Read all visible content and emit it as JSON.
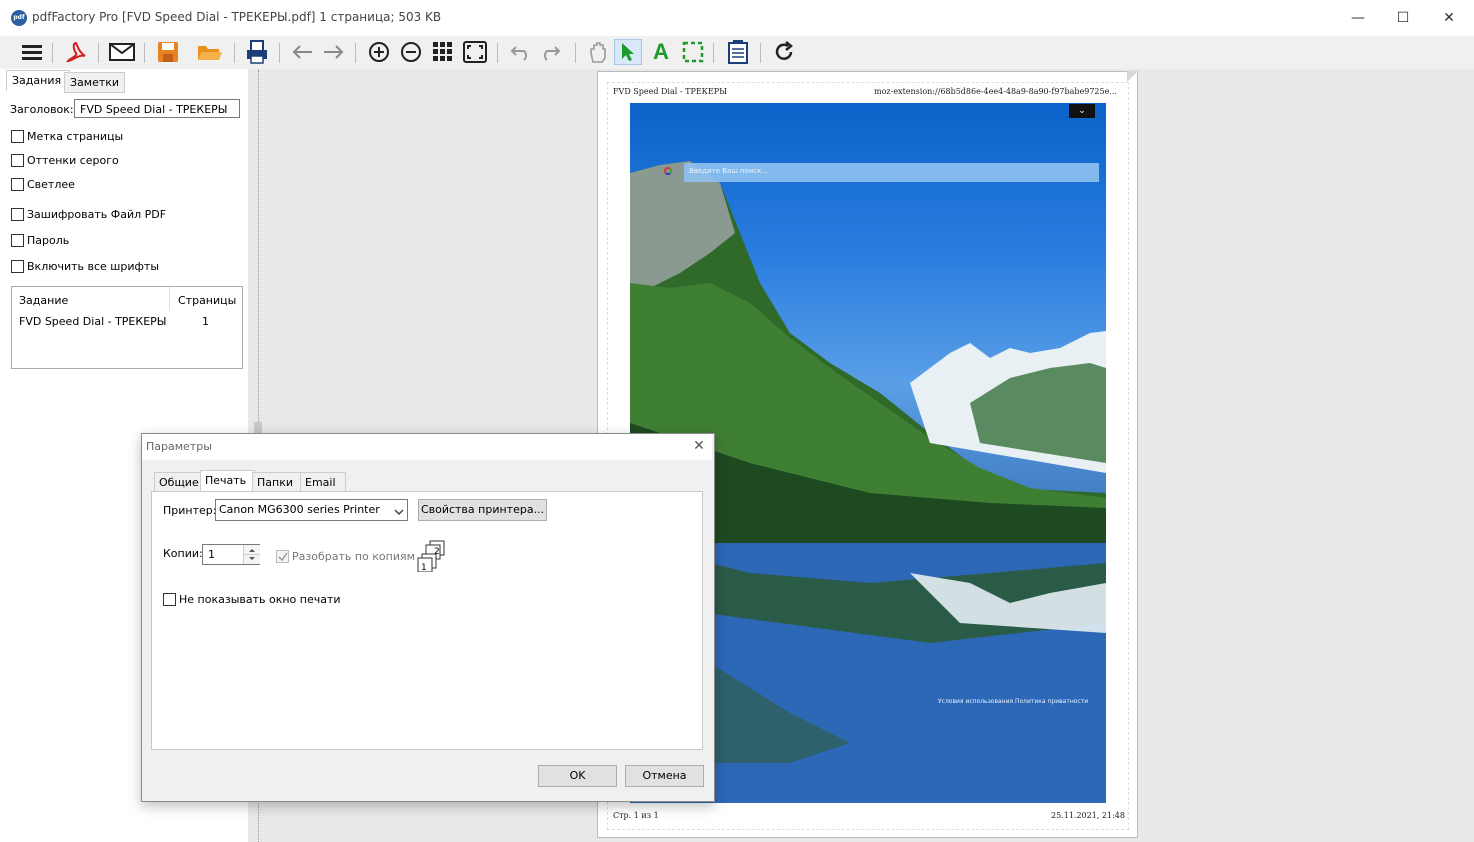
{
  "window": {
    "logo_text": "pdf",
    "title": "pdfFactory Pro [FVD Speed Dial - ТРЕКЕРЫ.pdf] 1 страница; 503 KB",
    "minimize": "—",
    "maximize": "☐",
    "close": "✕"
  },
  "toolbar": {
    "icons": [
      "menu-icon",
      "pdf-icon",
      "email-icon",
      "save-icon",
      "open-folder-icon",
      "print-icon",
      "back-arrow-icon",
      "forward-arrow-icon",
      "zoom-in-icon",
      "zoom-out-icon",
      "thumbnails-icon",
      "fit-page-icon",
      "undo-icon",
      "redo-icon",
      "hand-tool-icon",
      "select-arrow-icon",
      "text-tool-icon",
      "select-area-icon",
      "notes-icon",
      "refresh-icon"
    ],
    "text_tool_glyph": "A"
  },
  "left_panel": {
    "tabs": [
      "Задания",
      "Заметки"
    ],
    "title_label": "Заголовок:",
    "title_value": "FVD Speed Dial - ТРЕКЕРЫ",
    "options": [
      "Метка страницы",
      "Оттенки серого",
      "Светлее",
      "Зашифровать Файл PDF",
      "Пароль",
      "Включить все шрифты"
    ],
    "table": {
      "headers": [
        "Задание",
        "Страницы"
      ],
      "rows": [
        [
          "FVD Speed Dial - ТРЕКЕРЫ",
          "1"
        ]
      ]
    }
  },
  "preview": {
    "header_left": "FVD Speed Dial - ТРЕКЕРЫ",
    "header_right": "moz-extension://68b5d86e-4ee4-48a9-8a90-f97babe9725e...",
    "search_placeholder": "Введите Ваш поиск...",
    "dropdown_glyph": "⌄",
    "footer_links": "Условия использования   Политика приватности",
    "footer_left": "Стр. 1 из 1",
    "footer_right": "25.11.2021, 21:48"
  },
  "dialog": {
    "title": "Параметры",
    "close": "✕",
    "tabs": [
      "Общие",
      "Печать",
      "Папки",
      "Email"
    ],
    "active_tab": "Печать",
    "printer_label": "Принтер:",
    "printer_value": "Canon MG6300 series Printer",
    "printer_props_button": "Свойства принтера...",
    "copies_label": "Копии:",
    "copies_value": "1",
    "collate_label": "Разобрать по копиям",
    "collate_checked": true,
    "hide_print_window_label": "Не показывать окно печати",
    "ok_button": "OK",
    "cancel_button": "Отмена"
  }
}
